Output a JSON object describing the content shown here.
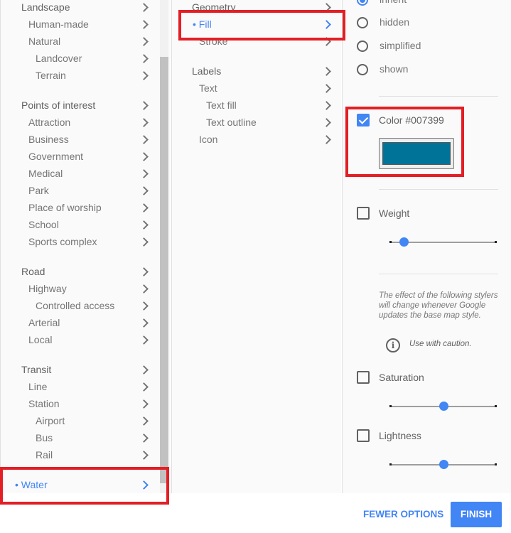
{
  "feature_types": [
    {
      "label": "Landscape",
      "level": 0
    },
    {
      "label": "Human-made",
      "level": 1
    },
    {
      "label": "Natural",
      "level": 1
    },
    {
      "label": "Landcover",
      "level": 2
    },
    {
      "label": "Terrain",
      "level": 2
    },
    {
      "label": "Points of interest",
      "level": 0,
      "gap": true
    },
    {
      "label": "Attraction",
      "level": 1
    },
    {
      "label": "Business",
      "level": 1
    },
    {
      "label": "Government",
      "level": 1
    },
    {
      "label": "Medical",
      "level": 1
    },
    {
      "label": "Park",
      "level": 1
    },
    {
      "label": "Place of worship",
      "level": 1
    },
    {
      "label": "School",
      "level": 1
    },
    {
      "label": "Sports complex",
      "level": 1
    },
    {
      "label": "Road",
      "level": 0,
      "gap": true
    },
    {
      "label": "Highway",
      "level": 1
    },
    {
      "label": "Controlled access",
      "level": 2
    },
    {
      "label": "Arterial",
      "level": 1
    },
    {
      "label": "Local",
      "level": 1
    },
    {
      "label": "Transit",
      "level": 0,
      "gap": true
    },
    {
      "label": "Line",
      "level": 1
    },
    {
      "label": "Station",
      "level": 1
    },
    {
      "label": "Airport",
      "level": 2
    },
    {
      "label": "Bus",
      "level": 2
    },
    {
      "label": "Rail",
      "level": 2
    },
    {
      "label": "Water",
      "level": 0,
      "gap": true,
      "selected": true
    }
  ],
  "element_types": [
    {
      "label": "Geometry",
      "level": 0
    },
    {
      "label": "Fill",
      "level": 1,
      "selected": true
    },
    {
      "label": "Stroke",
      "level": 1
    },
    {
      "label": "Labels",
      "level": 0,
      "gap": true
    },
    {
      "label": "Text",
      "level": 1
    },
    {
      "label": "Text fill",
      "level": 2
    },
    {
      "label": "Text outline",
      "level": 2
    },
    {
      "label": "Icon",
      "level": 1
    }
  ],
  "visibility": {
    "options": [
      "inherit",
      "hidden",
      "simplified",
      "shown"
    ],
    "selected": "inherit"
  },
  "color": {
    "label": "Color #007399",
    "checked": true,
    "value": "#007399"
  },
  "weight": {
    "label": "Weight",
    "checked": false,
    "slider_fraction": 0.13
  },
  "caution": {
    "text": "The effect of the following stylers will change whenever Google updates the base map style.",
    "note": "Use with caution."
  },
  "saturation": {
    "label": "Saturation",
    "checked": false,
    "slider_fraction": 0.5
  },
  "lightness": {
    "label": "Lightness",
    "checked": false,
    "slider_fraction": 0.5
  },
  "footer": {
    "fewer_options": "FEWER OPTIONS",
    "finish": "FINISH"
  },
  "colors": {
    "accent": "#4285f4",
    "highlight": "#e31e24"
  }
}
